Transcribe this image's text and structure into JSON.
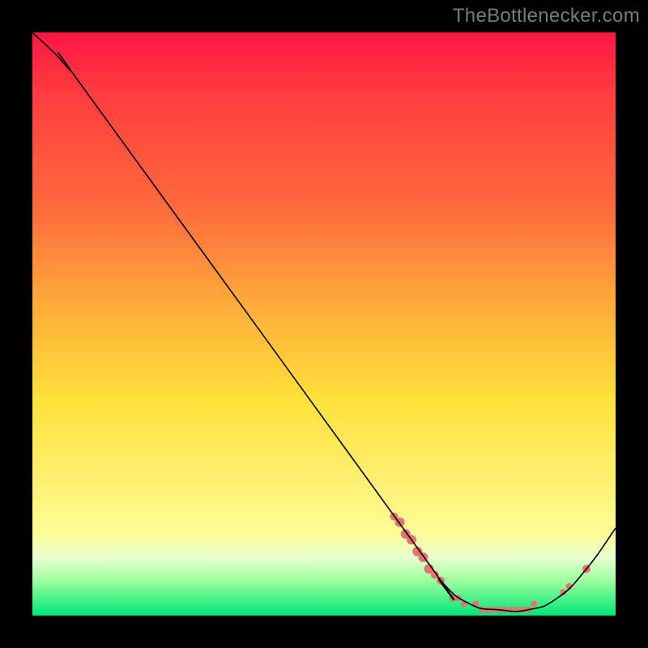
{
  "watermark": "TheBottlenecker.com",
  "chart_data": {
    "type": "line",
    "title": "",
    "xlabel": "",
    "ylabel": "",
    "xlim": [
      0,
      100
    ],
    "ylim": [
      0,
      100
    ],
    "grid": false,
    "legend": false,
    "background_gradient": {
      "stops": [
        {
          "pos": 0,
          "color": "#ff1744"
        },
        {
          "pos": 10,
          "color": "#ff3b3f"
        },
        {
          "pos": 30,
          "color": "#ff6a3d"
        },
        {
          "pos": 48,
          "color": "#ffb03a"
        },
        {
          "pos": 63,
          "color": "#ffe13a"
        },
        {
          "pos": 78,
          "color": "#fff176"
        },
        {
          "pos": 86,
          "color": "#fdfd96"
        },
        {
          "pos": 90,
          "color": "#e8ffd0"
        },
        {
          "pos": 94,
          "color": "#9dffa0"
        },
        {
          "pos": 100,
          "color": "#00e676"
        }
      ]
    },
    "series": [
      {
        "name": "curve",
        "color": "#000000",
        "stroke_width": 1.6,
        "data": [
          {
            "x": 0,
            "y": 100
          },
          {
            "x": 6,
            "y": 94
          },
          {
            "x": 12,
            "y": 86
          },
          {
            "x": 65,
            "y": 13
          },
          {
            "x": 70,
            "y": 6
          },
          {
            "x": 75,
            "y": 2
          },
          {
            "x": 80,
            "y": 1
          },
          {
            "x": 85,
            "y": 1
          },
          {
            "x": 90,
            "y": 3
          },
          {
            "x": 95,
            "y": 8
          },
          {
            "x": 100,
            "y": 15
          }
        ]
      }
    ],
    "markers": [
      {
        "x": 62,
        "y": 17,
        "r": 5,
        "color": "#e57373"
      },
      {
        "x": 63,
        "y": 16,
        "r": 6,
        "color": "#e57373"
      },
      {
        "x": 64,
        "y": 14,
        "r": 6,
        "color": "#e57373"
      },
      {
        "x": 65,
        "y": 13,
        "r": 6,
        "color": "#e57373"
      },
      {
        "x": 66,
        "y": 11,
        "r": 6,
        "color": "#e57373"
      },
      {
        "x": 67,
        "y": 10,
        "r": 6,
        "color": "#e57373"
      },
      {
        "x": 68,
        "y": 8,
        "r": 6,
        "color": "#e57373"
      },
      {
        "x": 69,
        "y": 7,
        "r": 5,
        "color": "#e57373"
      },
      {
        "x": 70,
        "y": 6,
        "r": 5,
        "color": "#e57373"
      },
      {
        "x": 72,
        "y": 3,
        "r": 4,
        "color": "#e57373"
      },
      {
        "x": 73,
        "y": 3,
        "r": 4,
        "color": "#e57373"
      },
      {
        "x": 74,
        "y": 2,
        "r": 4,
        "color": "#e57373"
      },
      {
        "x": 76,
        "y": 2,
        "r": 4,
        "color": "#e57373"
      },
      {
        "x": 77,
        "y": 1,
        "r": 4,
        "color": "#e57373"
      },
      {
        "x": 78,
        "y": 1,
        "r": 4,
        "color": "#e57373"
      },
      {
        "x": 79,
        "y": 1,
        "r": 4,
        "color": "#e57373"
      },
      {
        "x": 80,
        "y": 1,
        "r": 4,
        "color": "#e57373"
      },
      {
        "x": 81,
        "y": 1,
        "r": 4,
        "color": "#e57373"
      },
      {
        "x": 82,
        "y": 1,
        "r": 4,
        "color": "#e57373"
      },
      {
        "x": 83,
        "y": 1,
        "r": 4,
        "color": "#e57373"
      },
      {
        "x": 84,
        "y": 1,
        "r": 4,
        "color": "#e57373"
      },
      {
        "x": 85,
        "y": 1,
        "r": 4,
        "color": "#e57373"
      },
      {
        "x": 86,
        "y": 2,
        "r": 4,
        "color": "#e57373"
      },
      {
        "x": 91,
        "y": 4,
        "r": 4,
        "color": "#e57373"
      },
      {
        "x": 92,
        "y": 5,
        "r": 4,
        "color": "#e57373"
      },
      {
        "x": 95,
        "y": 8,
        "r": 5,
        "color": "#e57373"
      }
    ]
  }
}
